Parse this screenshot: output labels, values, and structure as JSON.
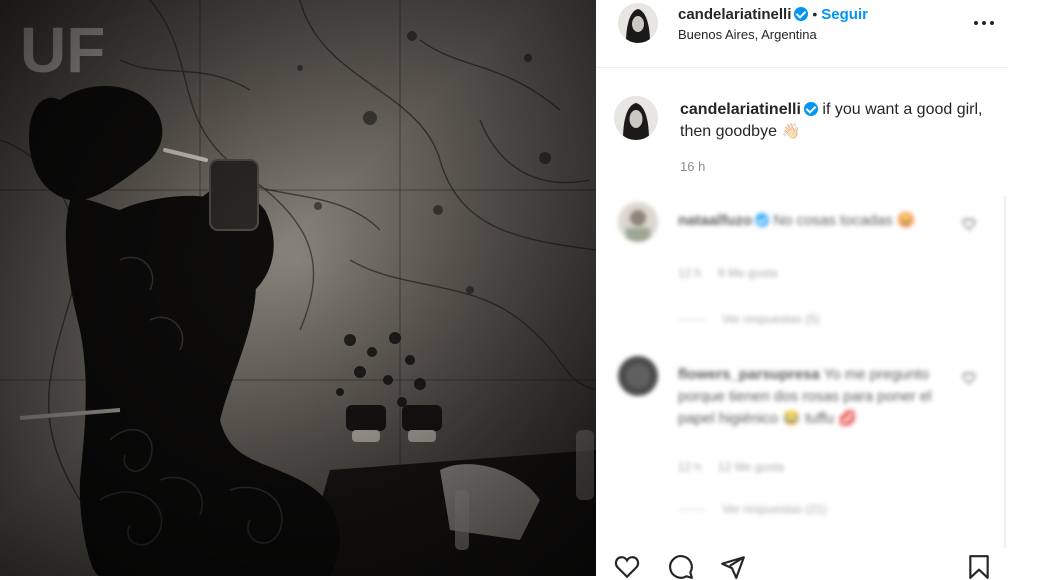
{
  "post": {
    "username": "candelariatinelli",
    "follow_label": "Seguir",
    "separator": "•",
    "location": "Buenos Aires, Argentina",
    "caption": "if you want a good girl, then goodbye",
    "caption_emoji": "👋🏻",
    "time": "16 h",
    "image_wall_text": "UF"
  },
  "comments": [
    {
      "username": "nataalfuzo",
      "text": "No cosas tocadas",
      "emoji": "😡",
      "time": "12 h",
      "likes": "9 Me gusta",
      "replies": "Ver respuestas (5)"
    },
    {
      "username": "flowers_parsupresa",
      "text": "Yo me pregunto porque tienen dos rosas para poner el papel higiénico",
      "emoji": "😂 tuffu 💋",
      "time": "12 h",
      "likes": "12 Me gusta",
      "replies": "Ver respuestas (21)"
    }
  ],
  "icons": {
    "more": "more-options-icon",
    "like": "heart-icon",
    "comment": "comment-icon",
    "share": "share-icon",
    "save": "bookmark-icon"
  },
  "colors": {
    "accent": "#0095f6",
    "text": "#262626",
    "muted": "#8e8e8e"
  }
}
